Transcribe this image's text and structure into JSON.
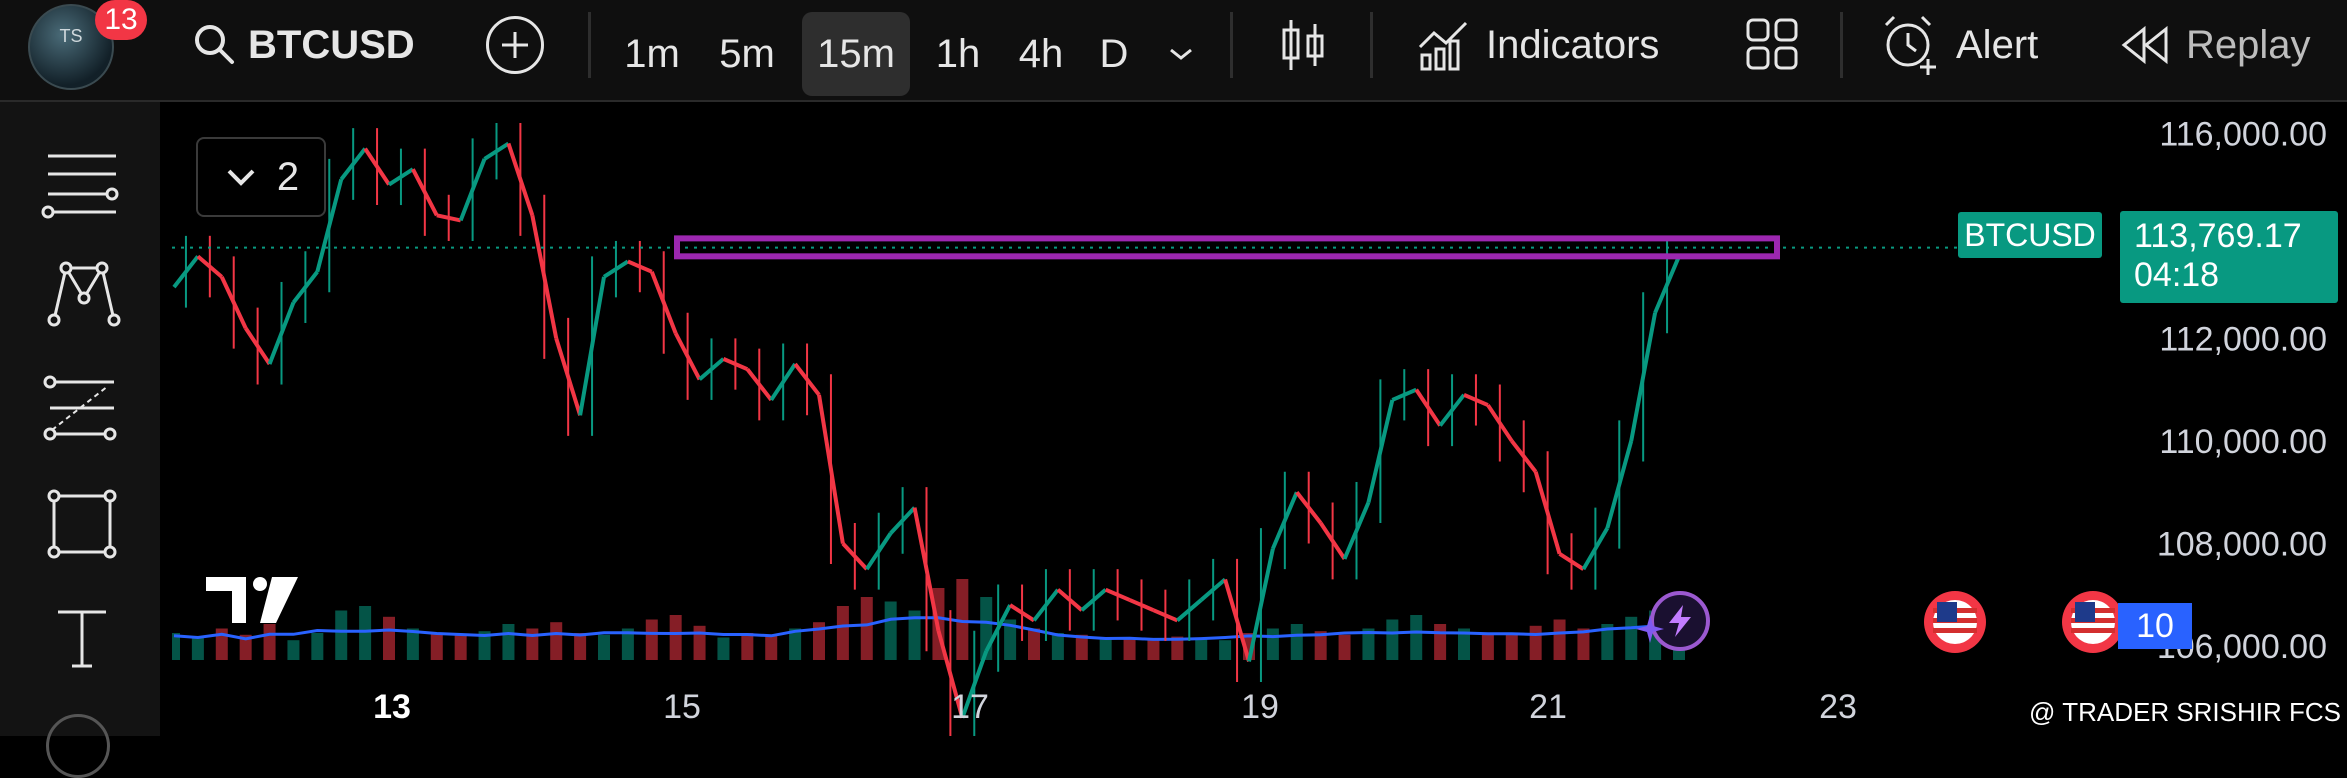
{
  "header": {
    "notification_count": "13",
    "symbol": "BTCUSD",
    "timeframes": [
      "1m",
      "5m",
      "15m",
      "1h",
      "4h",
      "D"
    ],
    "active_timeframe": "15m",
    "indicators_label": "Indicators",
    "alert_label": "Alert",
    "replay_label": "Replay"
  },
  "chart": {
    "layers_count": "2",
    "price_labels": [
      "116,000.00",
      "112,000.00",
      "110,000.00",
      "108,000.00",
      "106,000.00"
    ],
    "date_labels": [
      "13",
      "15",
      "17",
      "19",
      "21",
      "23"
    ],
    "symbol_tag": "BTCUSD",
    "current_price": "113,769.17",
    "countdown": "04:18",
    "event_badge_count": "10",
    "watermark": "@ TRADER SRISHIR FCS"
  },
  "chart_data": {
    "type": "line",
    "symbol": "BTCUSD",
    "x_labels": [
      "13",
      "15",
      "17",
      "19",
      "21",
      "23"
    ],
    "y_ticks": [
      116000,
      112000,
      110000,
      108000,
      106000
    ],
    "ylim": [
      104500,
      116200
    ],
    "current_price": 113769.17,
    "resistance_zone": [
      113600,
      113950
    ],
    "series": [
      {
        "values": [
          113000,
          113600,
          113200,
          112200,
          111500,
          112700,
          113300,
          115100,
          115700,
          115000,
          115300,
          114400,
          114300,
          115500,
          115800,
          114400,
          112000,
          110500,
          113200,
          113500,
          113300,
          112100,
          111200,
          111600,
          111400,
          110800,
          111500,
          110900,
          108000,
          107500,
          108200,
          108700,
          106300,
          104600,
          105900,
          106800,
          106500,
          107100,
          106700,
          107100,
          106900,
          106700,
          106500,
          106900,
          107300,
          105700,
          107900,
          109000,
          108400,
          107700,
          108800,
          110800,
          111000,
          110300,
          110900,
          110700,
          110000,
          109400,
          107800,
          107500,
          108300,
          110000,
          112500,
          113600
        ]
      }
    ],
    "volume": [
      30,
      25,
      35,
      28,
      40,
      22,
      30,
      55,
      60,
      48,
      35,
      30,
      28,
      32,
      40,
      35,
      42,
      30,
      28,
      35,
      45,
      50,
      38,
      25,
      30,
      28,
      35,
      42,
      60,
      70,
      65,
      55,
      80,
      90,
      70,
      45,
      35,
      30,
      28,
      25,
      24,
      22,
      26,
      24,
      22,
      30,
      35,
      40,
      32,
      28,
      35,
      45,
      50,
      40,
      35,
      30,
      28,
      38,
      45,
      35,
      40,
      48,
      55,
      65
    ]
  }
}
